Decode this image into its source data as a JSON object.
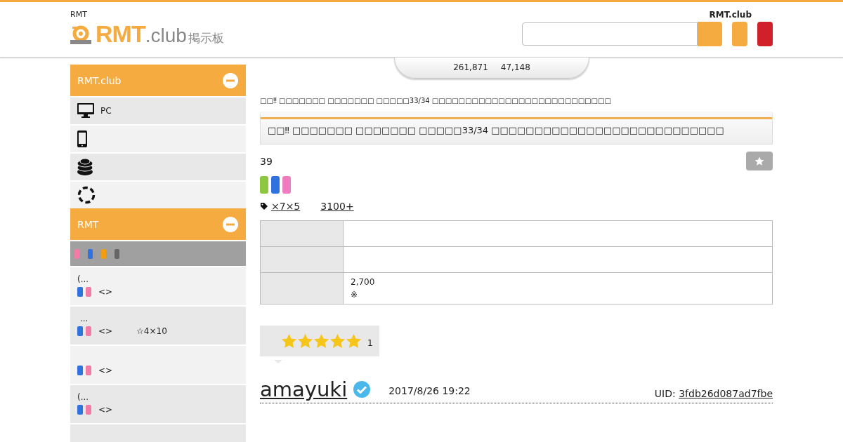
{
  "header": {
    "tagline": "RMT",
    "logo": {
      "main": "RMT",
      "suffix": ".club",
      "sub": "掲示板"
    },
    "site_name": "RMT.club"
  },
  "stats": [
    "261,871",
    "47,148"
  ],
  "sidebar": [
    {
      "title": "RMT.club",
      "expanded": true,
      "items": [
        {
          "kind": "monitor",
          "label": "PC"
        },
        {
          "kind": "phone"
        },
        {
          "kind": "coins"
        },
        {
          "kind": "ring"
        }
      ]
    },
    {
      "title": "RMT",
      "expanded": true,
      "filter": [
        {
          "color": "#f47ba6"
        },
        {
          "color": "#2f72e0"
        },
        {
          "color": "#f39c12"
        },
        {
          "color": "#666666"
        }
      ],
      "listings": [
        {
          "text": "(...",
          "tags": [
            {
              "color": "#2f72e0"
            },
            {
              "color": "#f07ca8"
            }
          ],
          "arrows": "<>"
        },
        {
          "text": " ...",
          "tags": [
            {
              "color": "#2f72e0"
            },
            {
              "color": "#f07ca8"
            }
          ],
          "arrows": "<>",
          "extra": "☆4×10"
        },
        {
          "tags": [
            {
              "color": "#2f72e0"
            },
            {
              "color": "#f07ca8"
            }
          ],
          "arrows": "<>"
        },
        {
          "text": "(...",
          "tags": [
            {
              "color": "#2f72e0"
            },
            {
              "color": "#f07ca8"
            }
          ],
          "arrows": "<>"
        }
      ]
    }
  ],
  "breadcrumb": "□□‼ □□□□□□□ □□□□□□□ □□□□□33/34 □□□□□□□□□□□□□□□□□□□□□□□□□□□",
  "title": "□□‼ □□□□□□□ □□□□□□□ □□□□□33/34 □□□□□□□□□□□□□□□□□□□□□□□□□□□",
  "post_number": "39",
  "platforms": [
    {
      "color": "#8dc63f"
    },
    {
      "color": "#2f72e0"
    },
    {
      "color": "#f07cc0"
    }
  ],
  "links": [
    "×7×5",
    "3100+"
  ],
  "table": {
    "rows": [
      {
        "lines": []
      },
      {
        "lines": []
      },
      {
        "lines": [
          "2,700",
          "※"
        ]
      }
    ]
  },
  "rating": {
    "stars": 5,
    "count": "1"
  },
  "author": {
    "name": "amayuki",
    "verified": true,
    "date": "2017/8/26 19:22",
    "uid_label": "UID:",
    "uid": "3fdb26d087ad7fbe"
  }
}
